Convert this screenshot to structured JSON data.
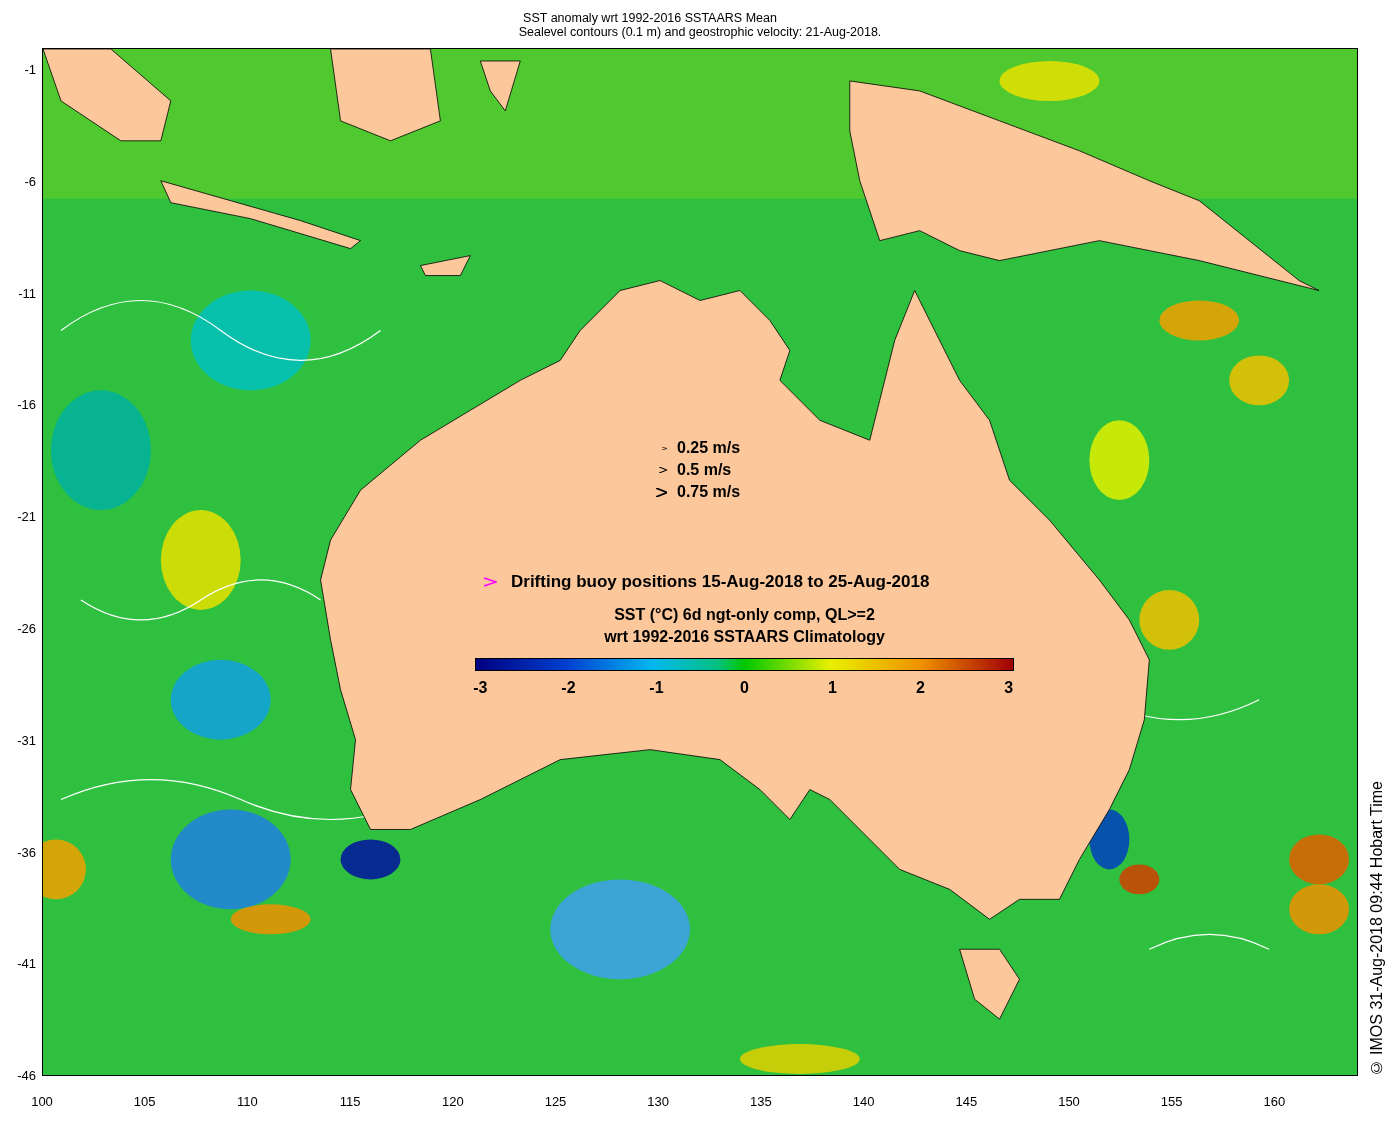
{
  "title": [
    "SST anomaly wrt 1992-2016 SSTAARS Mean",
    "Sealevel contours (0.1 m) and geostrophic velocity: 21-Aug-2018."
  ],
  "y_ticks": [
    "-1",
    "-6",
    "-11",
    "-16",
    "-21",
    "-26",
    "-31",
    "-36",
    "-41",
    "-46"
  ],
  "x_ticks": [
    "100",
    "105",
    "110",
    "115",
    "120",
    "125",
    "130",
    "135",
    "140",
    "145",
    "150",
    "155",
    "160"
  ],
  "speed_legend": [
    {
      "label": "0.25 m/s"
    },
    {
      "label": "0.5 m/s"
    },
    {
      "label": "0.75 m/s"
    }
  ],
  "buoy_legend": {
    "label": "Drifting buoy positions 15-Aug-2018 to 25-Aug-2018"
  },
  "colorbar": {
    "title": [
      "SST (°C) 6d ngt-only comp, QL>=2",
      "wrt 1992-2016 SSTAARS Climatology"
    ],
    "ticks": [
      "-3",
      "-2",
      "-1",
      "0",
      "1",
      "2",
      "3"
    ]
  },
  "credit": "© IMOS 31-Aug-2018 09:44 Hobart Time"
}
